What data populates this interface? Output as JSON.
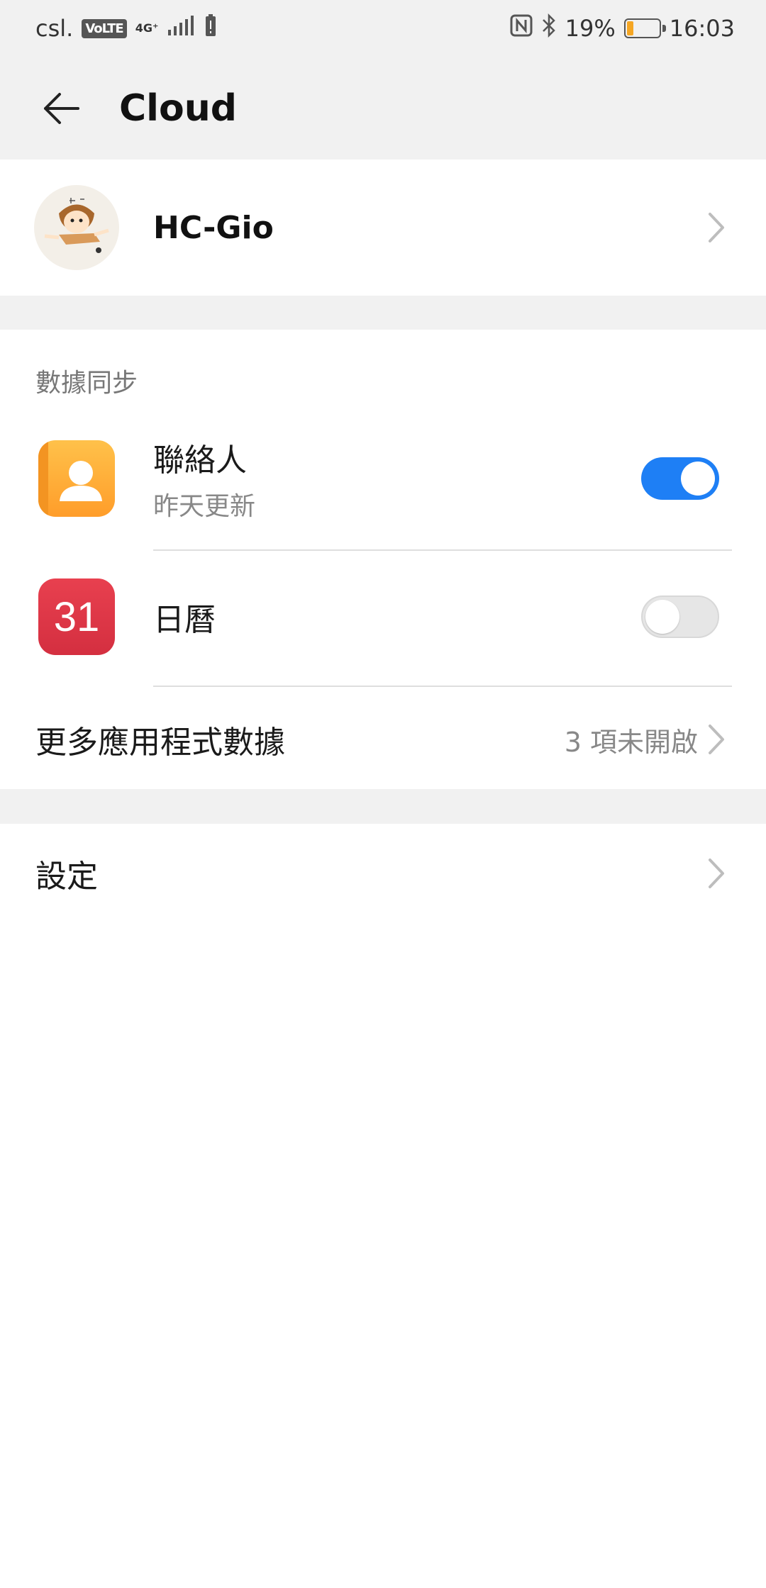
{
  "status_bar": {
    "carrier": "csl.",
    "volte": "VoLTE",
    "network": "4G⁺",
    "battery_percent": "19%",
    "battery_level": 0.19,
    "time": "16:03"
  },
  "header": {
    "title": "Cloud"
  },
  "account": {
    "name": "HC-Gio"
  },
  "sync": {
    "section_title": "數據同步",
    "items": [
      {
        "title": "聯絡人",
        "subtitle": "昨天更新",
        "enabled": true,
        "icon": "contacts-icon"
      },
      {
        "title": "日曆",
        "icon_text": "31",
        "enabled": false,
        "icon": "calendar-icon"
      }
    ],
    "more": {
      "title": "更多應用程式數據",
      "value": "3 項未開啟"
    }
  },
  "settings": {
    "title": "設定"
  },
  "colors": {
    "accent": "#1e7ff5",
    "background_gray": "#f1f1f1"
  }
}
